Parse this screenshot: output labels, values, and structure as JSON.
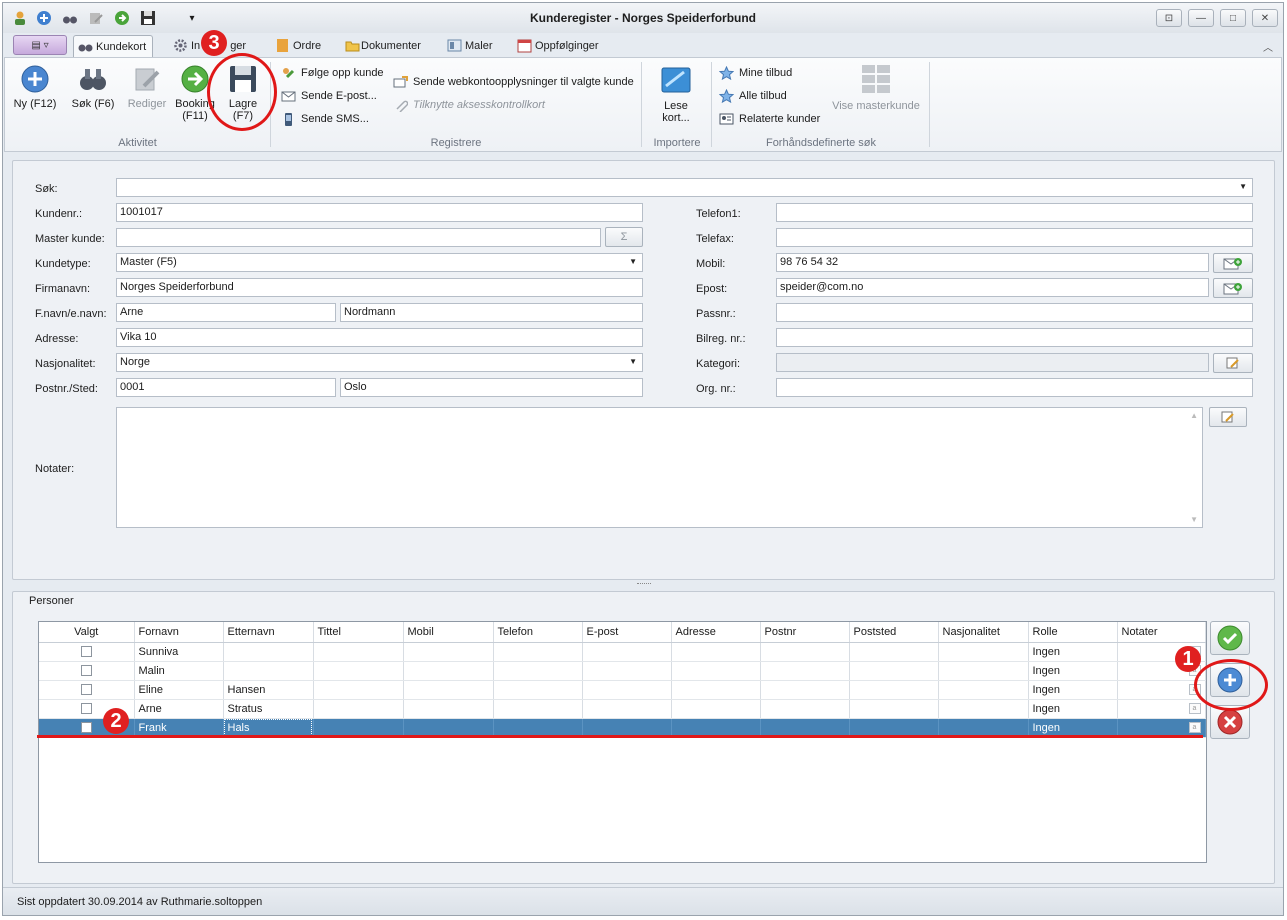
{
  "window": {
    "title": "Kunderegister - Norges Speiderforbund"
  },
  "tabs": [
    {
      "label": "Kundekort"
    },
    {
      "label": "In"
    },
    {
      "label": "ger"
    },
    {
      "label": "Ordre"
    },
    {
      "label": "Dokumenter"
    },
    {
      "label": "Maler"
    },
    {
      "label": "Oppfølginger"
    }
  ],
  "ribbon": {
    "aktivitet": {
      "label": "Aktivitet",
      "ny": "Ny (F12)",
      "sok": "Søk (F6)",
      "rediger": "Rediger",
      "booking_1": "Booking",
      "booking_2": "(F11)",
      "lagre_1": "Lagre",
      "lagre_2": "(F7)"
    },
    "registrere": {
      "label": "Registrere",
      "folge": "Følge opp kunde",
      "epost": "Sende E-post...",
      "sms": "Sende SMS...",
      "webkonto": "Sende webkontoopplysninger til valgte kunde",
      "tilknytte": "Tilknytte aksesskontrollkort"
    },
    "importere": {
      "label": "Importere",
      "lese_1": "Lese",
      "lese_2": "kort..."
    },
    "sok": {
      "label": "Forhåndsdefinerte søk",
      "mine": "Mine tilbud",
      "alle": "Alle tilbud",
      "relaterte": "Relaterte kunder",
      "master": "Vise masterkunde"
    }
  },
  "form": {
    "labels": {
      "sok": "Søk:",
      "kundenr": "Kundenr.:",
      "master": "Master kunde:",
      "kundetype": "Kundetype:",
      "firmanavn": "Firmanavn:",
      "navn": "F.navn/e.navn:",
      "adresse": "Adresse:",
      "nasjonalitet": "Nasjonalitet:",
      "postnr": "Postnr./Sted:",
      "notater": "Notater:",
      "telefon1": "Telefon1:",
      "telefax": "Telefax:",
      "mobil": "Mobil:",
      "epost": "Epost:",
      "passnr": "Passnr.:",
      "bilreg": "Bilreg. nr.:",
      "kategori": "Kategori:",
      "orgnr": "Org. nr.:"
    },
    "values": {
      "sok": "",
      "kundenr": "1001017",
      "master": "",
      "kundetype": "Master (F5)",
      "firmanavn": "Norges Speiderforbund",
      "fornavn": "Arne",
      "etternavn": "Nordmann",
      "adresse": "Vika 10",
      "nasjonalitet": "Norge",
      "postnr": "0001",
      "sted": "Oslo",
      "telefon1": "",
      "telefax": "",
      "mobil": "98 76 54 32",
      "epost": "speider@com.no",
      "passnr": "",
      "bilreg": "",
      "kategori": "",
      "orgnr": ""
    }
  },
  "persons": {
    "title": "Personer",
    "columns": [
      "Valgt",
      "Fornavn",
      "Etternavn",
      "Tittel",
      "Mobil",
      "Telefon",
      "E-post",
      "Adresse",
      "Postnr",
      "Poststed",
      "Nasjonalitet",
      "Rolle",
      "Notater"
    ],
    "rows": [
      {
        "fornavn": "Sunniva",
        "etternavn": "",
        "rolle": "Ingen"
      },
      {
        "fornavn": "Malin",
        "etternavn": "",
        "rolle": "Ingen"
      },
      {
        "fornavn": "Eline",
        "etternavn": "Hansen",
        "rolle": "Ingen"
      },
      {
        "fornavn": "Arne",
        "etternavn": "Stratus",
        "rolle": "Ingen"
      },
      {
        "fornavn": "Frank",
        "etternavn": "Hals",
        "rolle": "Ingen"
      }
    ]
  },
  "status": {
    "text": "Sist oppdatert 30.09.2014 av Ruthmarie.soltoppen"
  },
  "annotations": {
    "one": "1",
    "two": "2",
    "three": "3"
  },
  "colors": {
    "selection": "#4682b4",
    "annotation": "#e01818"
  }
}
